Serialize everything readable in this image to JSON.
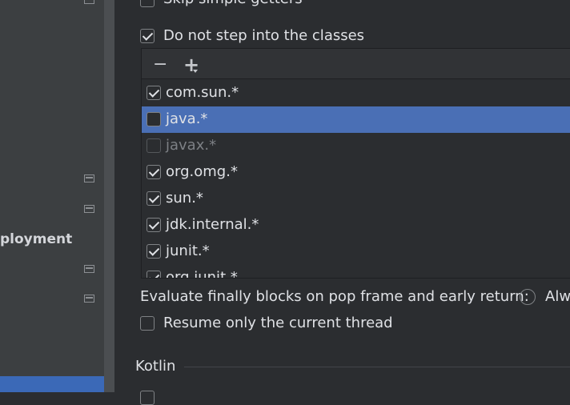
{
  "sidebar": {
    "label_partial": "ployment"
  },
  "settings": {
    "skip_simple_getters": {
      "label": "Skip simple getters",
      "checked": false
    },
    "do_not_step": {
      "label": "Do not step into the classes",
      "checked": true
    },
    "class_filters": [
      {
        "pattern": "com.sun.*",
        "checked": true,
        "selected": false,
        "enabled": true
      },
      {
        "pattern": "java.*",
        "checked": false,
        "selected": true,
        "enabled": true
      },
      {
        "pattern": "javax.*",
        "checked": false,
        "selected": false,
        "enabled": false
      },
      {
        "pattern": "org.omg.*",
        "checked": true,
        "selected": false,
        "enabled": true
      },
      {
        "pattern": "sun.*",
        "checked": true,
        "selected": false,
        "enabled": true
      },
      {
        "pattern": "jdk.internal.*",
        "checked": true,
        "selected": false,
        "enabled": true
      },
      {
        "pattern": "junit.*",
        "checked": true,
        "selected": false,
        "enabled": true
      },
      {
        "pattern": "org.junit.*",
        "checked": true,
        "selected": false,
        "enabled": true
      }
    ],
    "toolbar": {
      "remove_icon": "minus-icon",
      "add_icon": "plus-dropdown-icon"
    },
    "evaluate_finally": {
      "label": "Evaluate finally blocks on pop frame and early return:",
      "option_label": "Alw"
    },
    "resume_only": {
      "label": "Resume only the current thread",
      "checked": false
    },
    "kotlin_section": "Kotlin"
  },
  "colors": {
    "background": "#2b2d30",
    "sidebar": "#3c3f41",
    "selection": "#4a6fb5",
    "sidebar_selection": "#3b69b7"
  }
}
